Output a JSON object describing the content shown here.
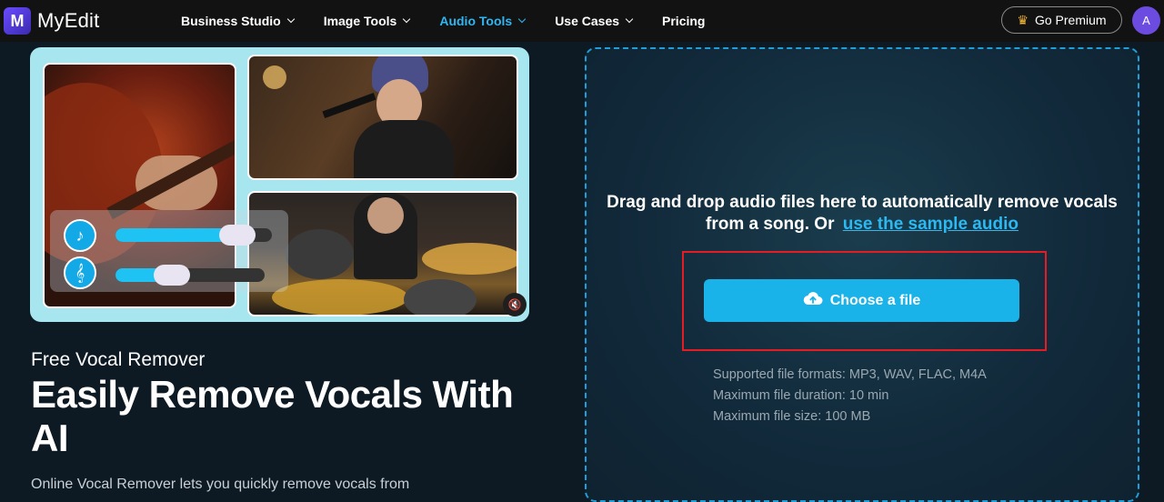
{
  "nav": {
    "logo_mark": "M",
    "logo_text": "MyEdit",
    "menu": [
      {
        "label": "Business Studio",
        "active": false
      },
      {
        "label": "Image Tools",
        "active": false
      },
      {
        "label": "Audio Tools",
        "active": true
      },
      {
        "label": "Use Cases",
        "active": false
      },
      {
        "label": "Pricing",
        "active": false
      }
    ],
    "premium_label": "Go Premium",
    "avatar_initial": "A"
  },
  "hero": {
    "sub_title": "Free Vocal Remover",
    "main_title": "Easily Remove Vocals With AI",
    "cut_text": "Online Vocal Remover lets you quickly remove vocals from",
    "sliders": [
      {
        "icon": "vocal-icon",
        "level": 0.85
      },
      {
        "icon": "music-note-icon",
        "level": 0.45
      }
    ]
  },
  "upload": {
    "drop_text": "Drag and drop audio files here to automatically remove vocals from a song. Or",
    "sample_link": "use the sample audio",
    "choose_label": "Choose a file",
    "formats": "Supported file formats: MP3, WAV, FLAC, M4A",
    "duration": "Maximum file duration: 10 min",
    "size": "Maximum file size: 100 MB"
  },
  "colors": {
    "accent": "#19b3ea",
    "active_nav": "#30b6f1",
    "highlight": "#e51c23",
    "nav_bg": "#121212"
  }
}
